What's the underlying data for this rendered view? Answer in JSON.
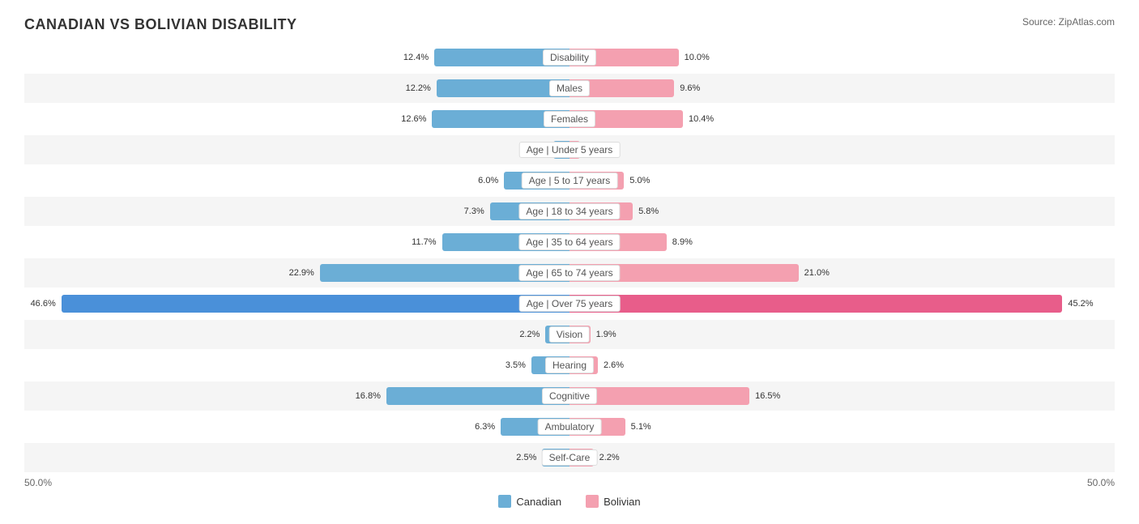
{
  "title": "CANADIAN VS BOLIVIAN DISABILITY",
  "source": "Source: ZipAtlas.com",
  "axis": {
    "left": "50.0%",
    "right": "50.0%"
  },
  "legend": {
    "canadian_label": "Canadian",
    "bolivian_label": "Bolivian",
    "canadian_color": "#6baed6",
    "bolivian_color": "#f4a0b0"
  },
  "rows": [
    {
      "label": "Disability",
      "left_val": "12.4%",
      "right_val": "10.0%",
      "left_pct": 24.8,
      "right_pct": 20.0,
      "shaded": false
    },
    {
      "label": "Males",
      "left_val": "12.2%",
      "right_val": "9.6%",
      "left_pct": 24.4,
      "right_pct": 19.2,
      "shaded": true
    },
    {
      "label": "Females",
      "left_val": "12.6%",
      "right_val": "10.4%",
      "left_pct": 25.2,
      "right_pct": 20.8,
      "shaded": false
    },
    {
      "label": "Age | Under 5 years",
      "left_val": "1.5%",
      "right_val": "1.0%",
      "left_pct": 3.0,
      "right_pct": 2.0,
      "shaded": true
    },
    {
      "label": "Age | 5 to 17 years",
      "left_val": "6.0%",
      "right_val": "5.0%",
      "left_pct": 12.0,
      "right_pct": 10.0,
      "shaded": false
    },
    {
      "label": "Age | 18 to 34 years",
      "left_val": "7.3%",
      "right_val": "5.8%",
      "left_pct": 14.6,
      "right_pct": 11.6,
      "shaded": true
    },
    {
      "label": "Age | 35 to 64 years",
      "left_val": "11.7%",
      "right_val": "8.9%",
      "left_pct": 23.4,
      "right_pct": 17.8,
      "shaded": false
    },
    {
      "label": "Age | 65 to 74 years",
      "left_val": "22.9%",
      "right_val": "21.0%",
      "left_pct": 45.8,
      "right_pct": 42.0,
      "shaded": true
    },
    {
      "label": "Age | Over 75 years",
      "left_val": "46.6%",
      "right_val": "45.2%",
      "left_pct": 93.2,
      "right_pct": 90.4,
      "shaded": false,
      "highlight": true
    },
    {
      "label": "Vision",
      "left_val": "2.2%",
      "right_val": "1.9%",
      "left_pct": 4.4,
      "right_pct": 3.8,
      "shaded": true
    },
    {
      "label": "Hearing",
      "left_val": "3.5%",
      "right_val": "2.6%",
      "left_pct": 7.0,
      "right_pct": 5.2,
      "shaded": false
    },
    {
      "label": "Cognitive",
      "left_val": "16.8%",
      "right_val": "16.5%",
      "left_pct": 33.6,
      "right_pct": 33.0,
      "shaded": true
    },
    {
      "label": "Ambulatory",
      "left_val": "6.3%",
      "right_val": "5.1%",
      "left_pct": 12.6,
      "right_pct": 10.2,
      "shaded": false
    },
    {
      "label": "Self-Care",
      "left_val": "2.5%",
      "right_val": "2.2%",
      "left_pct": 5.0,
      "right_pct": 4.4,
      "shaded": true
    }
  ]
}
